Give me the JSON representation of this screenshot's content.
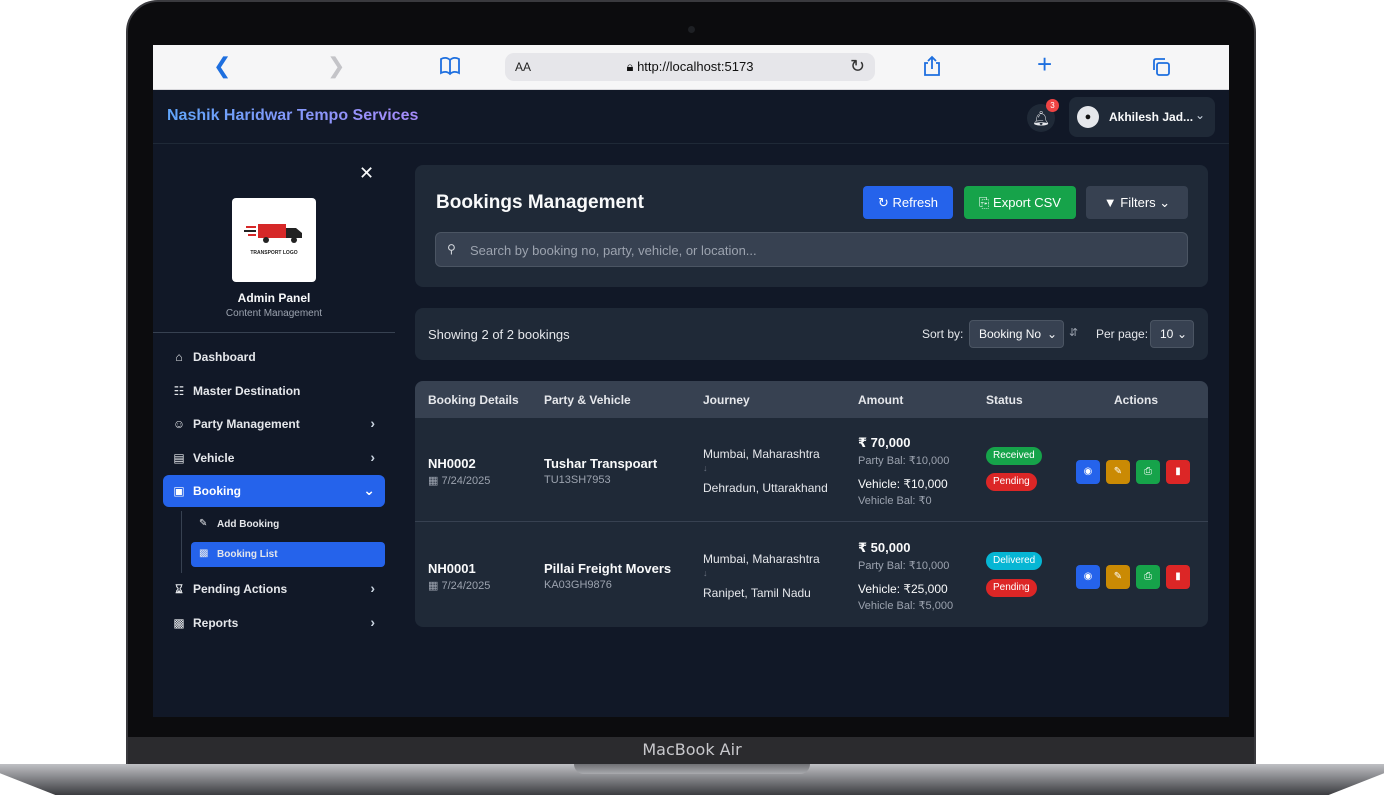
{
  "device": {
    "model": "MacBook Air"
  },
  "browser": {
    "back_icon": "chevron-left-icon",
    "forward_icon": "chevron-right-icon",
    "text_size_label": "AA",
    "url": "http://localhost:5173"
  },
  "header": {
    "brand": "Nashik Haridwar Tempo Services",
    "notification_count": "3",
    "user_name": "Akhilesh Jad..."
  },
  "sidebar": {
    "logo_text": "TRANSPORT LOGO",
    "title": "Admin Panel",
    "subtitle": "Content Management",
    "items": [
      {
        "label": "Dashboard",
        "icon": "home-icon"
      },
      {
        "label": "Master Destination",
        "icon": "sitemap-icon"
      },
      {
        "label": "Party Management",
        "icon": "user-edit-icon"
      },
      {
        "label": "Vehicle",
        "icon": "archive-icon"
      },
      {
        "label": "Booking",
        "icon": "booking-icon"
      },
      {
        "label": "Pending Actions",
        "icon": "hourglass-icon"
      },
      {
        "label": "Reports",
        "icon": "chart-icon"
      }
    ],
    "booking_sub": [
      {
        "label": "Add Booking",
        "icon": "edit-icon"
      },
      {
        "label": "Booking List",
        "icon": "briefcase-icon"
      }
    ]
  },
  "main": {
    "title": "Bookings Management",
    "refresh_label": "Refresh",
    "export_label": "Export CSV",
    "filters_label": "Filters",
    "search_placeholder": "Search by booking no, party, vehicle, or location...",
    "showing": "Showing 2 of 2 bookings",
    "sort_label": "Sort by:",
    "sort_value": "Booking No",
    "per_page_label": "Per page:",
    "per_page_value": "10",
    "columns": [
      "Booking Details",
      "Party & Vehicle",
      "Journey",
      "Amount",
      "Status",
      "Actions"
    ],
    "rows": [
      {
        "booking_no": "NH0002",
        "date": "7/24/2025",
        "party": "Tushar Transpoart",
        "vehicle": "TU13SH7953",
        "from": "Mumbai, Maharashtra",
        "arrow": "↓",
        "to": "Dehradun, Uttarakhand",
        "amount": "₹ 70,000",
        "party_bal": "Party Bal: ₹10,000",
        "vehicle_amt": "Vehicle: ₹10,000",
        "vehicle_bal": "Vehicle Bal: ₹0",
        "status1": "Received",
        "status2": "Pending"
      },
      {
        "booking_no": "NH0001",
        "date": "7/24/2025",
        "party": "Pillai Freight Movers",
        "vehicle": "KA03GH9876",
        "from": "Mumbai, Maharashtra",
        "arrow": "↓",
        "to": "Ranipet, Tamil Nadu",
        "amount": "₹ 50,000",
        "party_bal": "Party Bal: ₹10,000",
        "vehicle_amt": "Vehicle: ₹25,000",
        "vehicle_bal": "Vehicle Bal: ₹5,000",
        "status1": "Delivered",
        "status2": "Pending"
      }
    ]
  },
  "colors": {
    "primary": "#2563eb",
    "success": "#16a34a",
    "warning": "#ca8a04",
    "danger": "#dc2626",
    "info": "#06b6d4",
    "background": "#111827",
    "panel": "#1f2937"
  }
}
